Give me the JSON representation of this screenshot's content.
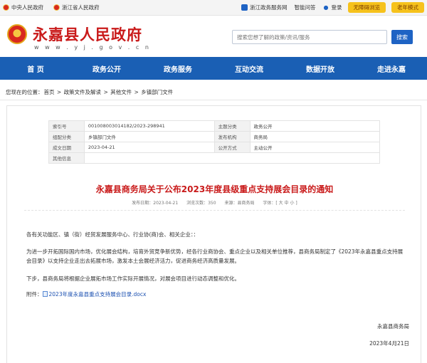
{
  "topbar": {
    "links": [
      "中央人民政府",
      "浙江省人民政府"
    ],
    "zwfw": "浙江政务服务网",
    "ask": "智能问答",
    "login": "登录",
    "barrier_free": "无障碍浏览",
    "elder_mode": "老年模式"
  },
  "header": {
    "title": "永嘉县人民政府",
    "url": "w w w . y j . g o v . c n",
    "search_placeholder": "搜索您想了解的政策/资讯/服务",
    "search_button": "搜索"
  },
  "nav": [
    "首 页",
    "政务公开",
    "政务服务",
    "互动交流",
    "数据开放",
    "走进永嘉"
  ],
  "breadcrumb": {
    "prefix": "您现在的位置：",
    "items": [
      "首页",
      "政策文件及解读",
      "其他文件",
      "乡镇部门文件"
    ],
    "separator": " > "
  },
  "meta": {
    "rows": [
      {
        "k1": "索引号",
        "v1": "001008003014182/2023-298941",
        "k2": "主题分类",
        "v2": "政务公开"
      },
      {
        "k1": "组配分类",
        "v1": "乡镇部门文件",
        "k2": "发布机构",
        "v2": "商务局"
      },
      {
        "k1": "成文日期",
        "v1": "2023-04-21",
        "k2": "公开方式",
        "v2": "主动公开"
      },
      {
        "k1": "其他信息",
        "v1": "",
        "k2": "",
        "v2": ""
      }
    ]
  },
  "doc": {
    "title": "永嘉县商务局关于公布2023年度县级重点支持展会目录的通知",
    "publish_date": "发布日期：2023-04-21",
    "views": "浏览次数：350",
    "source": "来源：县商务局",
    "font_size": "字体：[ 大 中 小 ]",
    "salutation": "各有关功能区、镇（街）经贸发展服务中心、行业协(商)会、相关企业：：",
    "para1": "为进一步开拓国际国内市场，优化展会结构，培育外贸竞争新优势，经各行业商协会、重点企业以及相关单位推荐，县商务局制定了《2023年永嘉县重点支持展会目录》以支持企业走出去拓展市场，激发本土会展经济活力，促进商务经济高质量发展。",
    "para2": "下步，县商务局将根据企业展拓市场工作实际开展情况，对展会项目进行动态调整和优化。",
    "attachment_label": "附件：",
    "attachment": "2023年度永嘉县重点支持展会目录.docx",
    "signer": "永嘉县商务局",
    "sign_date": "2023年4月21日"
  }
}
